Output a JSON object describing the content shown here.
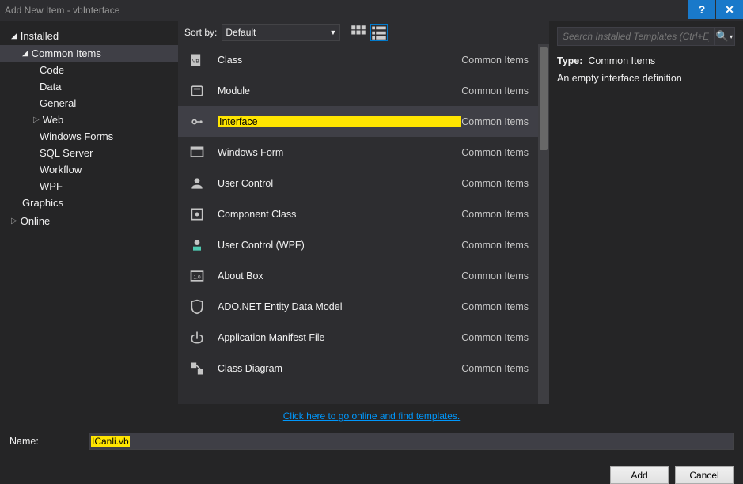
{
  "title": "Add New Item - vbInterface",
  "sidebar": {
    "root": "Installed",
    "group1": "Common Items",
    "items": [
      "Code",
      "Data",
      "General",
      "Web",
      "Windows Forms",
      "SQL Server",
      "Workflow",
      "WPF"
    ],
    "group2": "Graphics",
    "root2": "Online"
  },
  "toolbar": {
    "sort_lbl": "Sort by:",
    "sort_val": "Default",
    "search_ph": "Search Installed Templates (Ctrl+E)"
  },
  "templates": [
    {
      "name": "Class",
      "cat": "Common Items"
    },
    {
      "name": "Module",
      "cat": "Common Items"
    },
    {
      "name": "Interface",
      "cat": "Common Items",
      "sel": true
    },
    {
      "name": "Windows Form",
      "cat": "Common Items"
    },
    {
      "name": "User Control",
      "cat": "Common Items"
    },
    {
      "name": "Component Class",
      "cat": "Common Items"
    },
    {
      "name": "User Control (WPF)",
      "cat": "Common Items"
    },
    {
      "name": "About Box",
      "cat": "Common Items"
    },
    {
      "name": "ADO.NET Entity Data Model",
      "cat": "Common Items"
    },
    {
      "name": "Application Manifest File",
      "cat": "Common Items"
    },
    {
      "name": "Class Diagram",
      "cat": "Common Items"
    }
  ],
  "detail": {
    "type_lbl": "Type:",
    "type_val": "Common Items",
    "desc": "An empty interface definition"
  },
  "link": "Click here to go online and find templates.",
  "name_lbl": "Name:",
  "name_val": "ICanli.vb",
  "btns": {
    "add": "Add",
    "cancel": "Cancel"
  }
}
